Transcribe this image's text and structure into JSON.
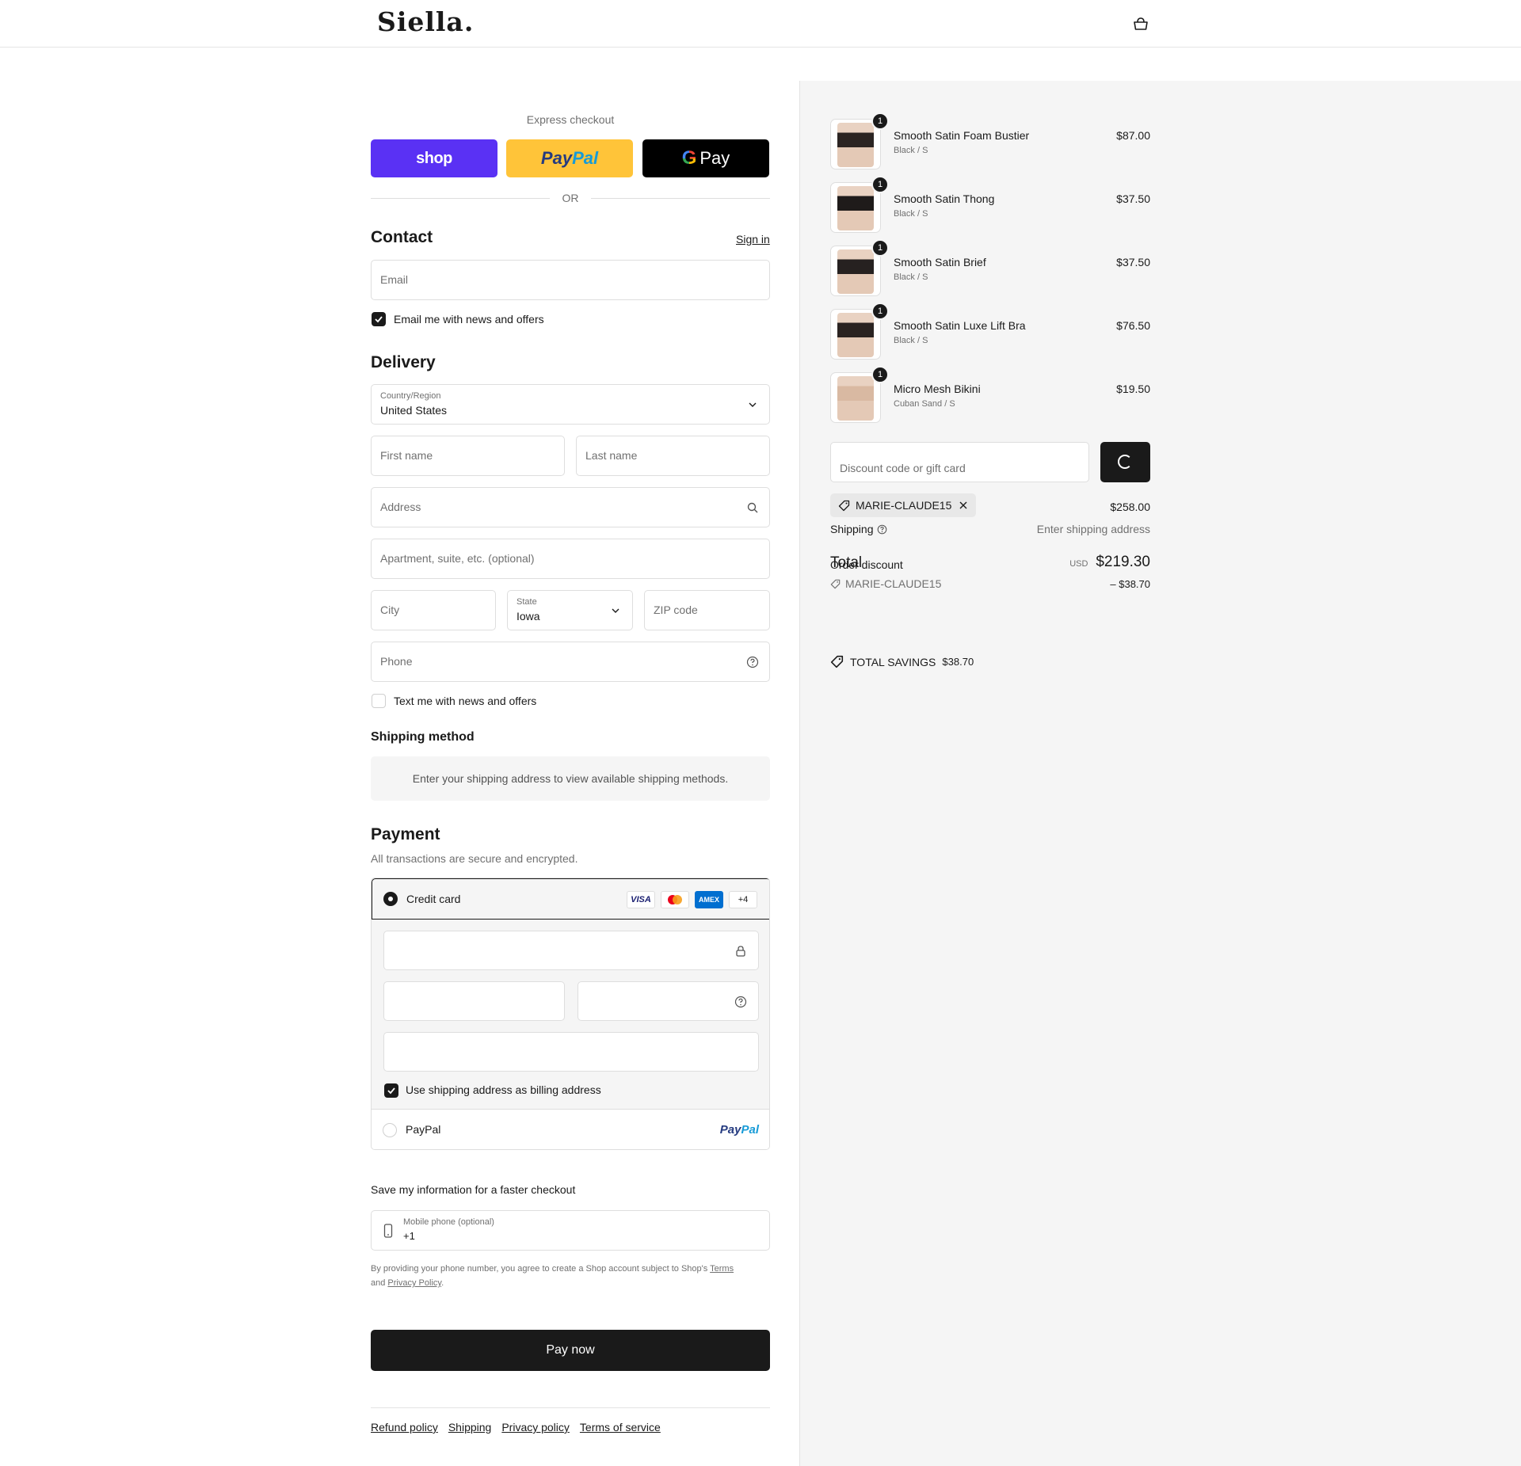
{
  "header": {
    "logo": "Siella."
  },
  "express": {
    "title": "Express checkout",
    "shop_label": "shop",
    "paypal_label_a": "Pay",
    "paypal_label_b": "Pal",
    "gpay_g": "G",
    "gpay_label": "Pay",
    "or": "OR"
  },
  "contact": {
    "title": "Contact",
    "sign_in": "Sign in",
    "email_placeholder": "Email",
    "news_label": "Email me with news and offers",
    "news_checked": true
  },
  "delivery": {
    "title": "Delivery",
    "country_label": "Country/Region",
    "country_value": "United States",
    "first_name": "First name",
    "last_name": "Last name",
    "address": "Address",
    "apartment": "Apartment, suite, etc. (optional)",
    "city": "City",
    "state_label": "State",
    "state_value": "Iowa",
    "zip": "ZIP code",
    "phone": "Phone",
    "text_label": "Text me with news and offers",
    "text_checked": false
  },
  "shipping_method": {
    "title": "Shipping method",
    "message": "Enter your shipping address to view available shipping methods."
  },
  "payment": {
    "title": "Payment",
    "subtitle": "All transactions are secure and encrypted.",
    "credit_card": "Credit card",
    "badges": [
      "VISA",
      "",
      "AMEX",
      "+4"
    ],
    "billing_label": "Use shipping address as billing address",
    "billing_checked": true,
    "paypal": "PayPal",
    "paypal_logo_a": "Pay",
    "paypal_logo_b": "Pal"
  },
  "save_info": {
    "title": "Save my information for a faster checkout",
    "phone_label": "Mobile phone (optional)",
    "phone_value": "+1"
  },
  "legal": {
    "text1": "By providing your phone number, you agree to create a Shop account subject to Shop's",
    "terms": "Terms",
    "and": "and",
    "privacy": "Privacy Policy",
    "period": "."
  },
  "pay_now": "Pay now",
  "footer": {
    "links": [
      "Refund policy",
      "Shipping",
      "Privacy policy",
      "Terms of service"
    ]
  },
  "cart": {
    "items": [
      {
        "name": "Smooth Satin Foam Bustier",
        "variant": "Black / S",
        "price": "$87.00",
        "qty": "1",
        "swatch": "#2b2422"
      },
      {
        "name": "Smooth Satin Thong",
        "variant": "Black / S",
        "price": "$37.50",
        "qty": "1",
        "swatch": "#1f1b1a"
      },
      {
        "name": "Smooth Satin Brief",
        "variant": "Black / S",
        "price": "$37.50",
        "qty": "1",
        "swatch": "#262120"
      },
      {
        "name": "Smooth Satin Luxe Lift Bra",
        "variant": "Black / S",
        "price": "$76.50",
        "qty": "1",
        "swatch": "#2a2321"
      },
      {
        "name": "Micro Mesh Bikini",
        "variant": "Cuban Sand / S",
        "price": "$19.50",
        "qty": "1",
        "swatch": "#d9b9a2"
      }
    ],
    "discount_placeholder": "Discount code or gift card",
    "code": "MARIE-CLAUDE15",
    "subtotal": "$258.00",
    "shipping_label": "Shipping",
    "shipping_value": "Enter shipping address",
    "total_label": "Total",
    "order_discount_label": "Order discount",
    "currency": "USD",
    "total": "$219.30",
    "discount_code": "MARIE-CLAUDE15",
    "discount_value": "– $38.70",
    "savings_label": "TOTAL SAVINGS",
    "savings_value": "$38.70"
  }
}
